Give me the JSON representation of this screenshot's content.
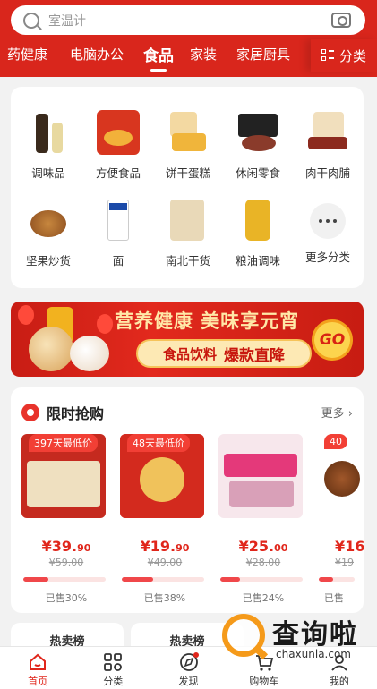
{
  "search": {
    "placeholder": "室温计"
  },
  "category_tabs": [
    "药健康",
    "电脑办公",
    "食品",
    "家装",
    "家居厨具"
  ],
  "category_active": "食品",
  "category_button": "分类",
  "grid_items": [
    {
      "label": "调味品"
    },
    {
      "label": "方便食品"
    },
    {
      "label": "饼干蛋糕"
    },
    {
      "label": "休闲零食"
    },
    {
      "label": "肉干肉脯"
    },
    {
      "label": "坚果炒货"
    },
    {
      "label": "面"
    },
    {
      "label": "南北干货"
    },
    {
      "label": "粮油调味"
    },
    {
      "label": "更多分类"
    }
  ],
  "banner": {
    "title": "营养健康 美味享元宵",
    "pill_a": "食品饮料",
    "pill_b": "爆款直降",
    "go": "GO"
  },
  "flash_sale": {
    "title": "限时抢购",
    "more": "更多",
    "products": [
      {
        "tag": "397天最低价",
        "price_int": "¥39.",
        "price_dec": "90",
        "old": "¥59.00",
        "sold_pct": 30,
        "sold": "已售30%"
      },
      {
        "tag": "48天最低价",
        "price_int": "¥19.",
        "price_dec": "90",
        "old": "¥49.00",
        "sold_pct": 38,
        "sold": "已售38%"
      },
      {
        "tag": "",
        "price_int": "¥25.",
        "price_dec": "00",
        "old": "¥28.00",
        "sold_pct": 24,
        "sold": "已售24%"
      },
      {
        "tag": "40",
        "price_int": "¥16",
        "price_dec": "",
        "old": "¥19",
        "sold_pct": 40,
        "sold": "已售"
      }
    ]
  },
  "hot_labels": [
    "热卖榜",
    "热卖榜"
  ],
  "tabbar": [
    {
      "label": "首页",
      "icon": "home-icon"
    },
    {
      "label": "分类",
      "icon": "category-icon"
    },
    {
      "label": "发现",
      "icon": "discover-icon"
    },
    {
      "label": "购物车",
      "icon": "cart-icon"
    },
    {
      "label": "我的",
      "icon": "profile-icon"
    }
  ],
  "watermark": {
    "cn": "查询啦",
    "en": "chaxunla.com"
  },
  "colors": {
    "brand_red": "#d9261c",
    "price_red": "#e0261b",
    "progress": "#f0474a"
  }
}
